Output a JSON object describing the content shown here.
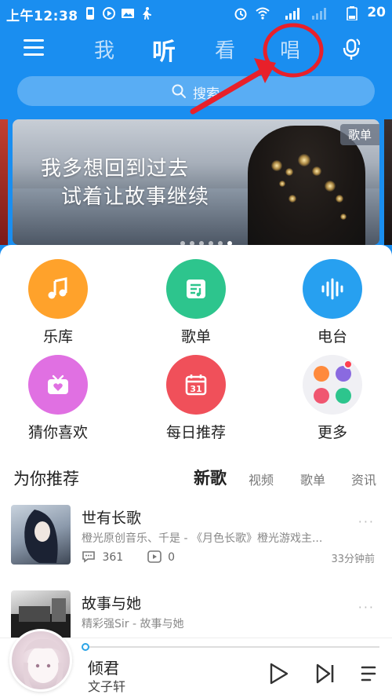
{
  "status_bar": {
    "time": "上午12:38",
    "battery": "20"
  },
  "nav": {
    "tabs": [
      {
        "label": "我"
      },
      {
        "label": "听"
      },
      {
        "label": "看"
      },
      {
        "label": "唱"
      }
    ],
    "active_tab": "听"
  },
  "search": {
    "placeholder": "搜索"
  },
  "banner": {
    "line1": "我多想回到过去",
    "line2": "试着让故事继续",
    "badge": "歌单",
    "dot_count": 6,
    "active_dot": 6
  },
  "shortcuts": [
    {
      "label": "乐库",
      "color": "#ffa22b",
      "icon": "music-note-icon"
    },
    {
      "label": "歌单",
      "color": "#2dc58d",
      "icon": "playlist-icon"
    },
    {
      "label": "电台",
      "color": "#27a0f0",
      "icon": "soundwave-icon"
    },
    {
      "label": "猜你喜欢",
      "color": "#e070e2",
      "icon": "radio-heart-icon"
    },
    {
      "label": "每日推荐",
      "color": "#f0505a",
      "icon": "calendar-icon",
      "day": "31"
    },
    {
      "label": "更多",
      "color": "#f0f0f4",
      "icon": "more-apps-icon"
    }
  ],
  "recommend": {
    "title": "为你推荐",
    "tabs": [
      "新歌",
      "视频",
      "歌单",
      "资讯"
    ],
    "active_tab": "新歌",
    "items": [
      {
        "title": "世有长歌",
        "subtitle": "橙光原创音乐、千是 - 《月色长歌》橙光游戏主...",
        "comments": "361",
        "plays": "0",
        "time": "33分钟前",
        "more": "···"
      },
      {
        "title": "故事与她",
        "subtitle": "精彩强Sir - 故事与她",
        "more": "···"
      }
    ]
  },
  "player": {
    "title": "倾君",
    "artist": "文子轩"
  },
  "colors": {
    "header_blue": "#1a8ef0",
    "annotation_red": "#e8202a",
    "progress_accent": "#2ba4e6"
  }
}
